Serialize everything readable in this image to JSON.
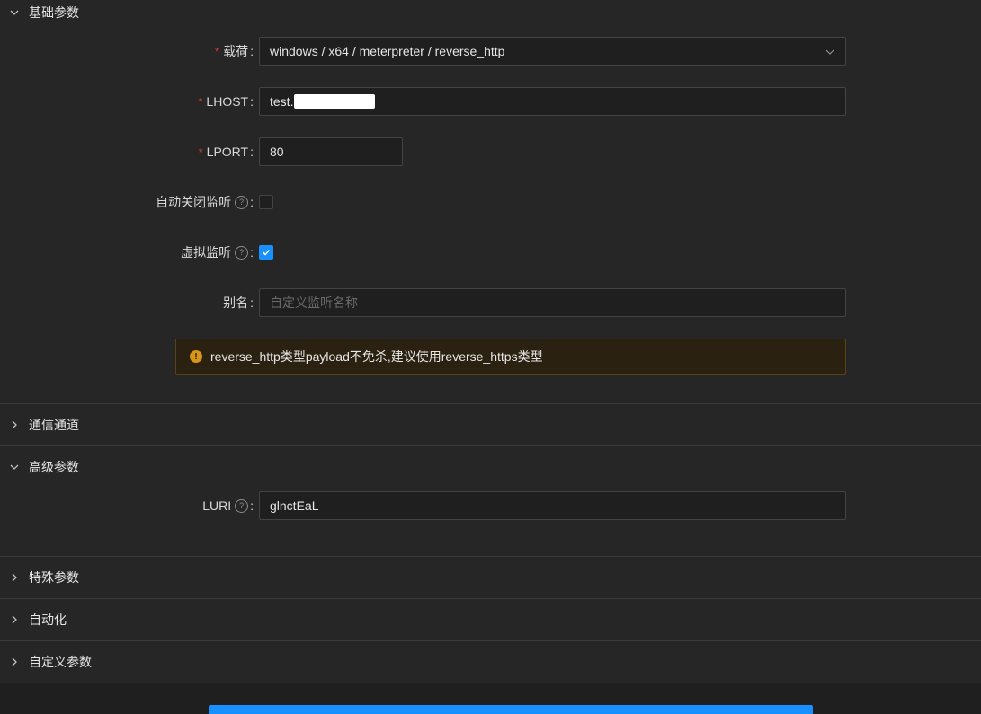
{
  "panels": {
    "basic": {
      "title": "基础参数",
      "expanded": true
    },
    "channel": {
      "title": "通信通道",
      "expanded": false
    },
    "advanced": {
      "title": "高级参数",
      "expanded": true
    },
    "special": {
      "title": "特殊参数",
      "expanded": false
    },
    "automation": {
      "title": "自动化",
      "expanded": false
    },
    "custom": {
      "title": "自定义参数",
      "expanded": false
    }
  },
  "form": {
    "payload": {
      "label": "载荷",
      "value": "windows / x64 / meterpreter / reverse_http",
      "required": true
    },
    "lhost": {
      "label": "LHOST",
      "value": "test.",
      "required": true
    },
    "lport": {
      "label": "LPORT",
      "value": "80",
      "required": true
    },
    "auto_close": {
      "label": "自动关闭监听",
      "checked": false
    },
    "virtual": {
      "label": "虚拟监听",
      "checked": true
    },
    "alias": {
      "label": "别名",
      "value": "",
      "placeholder": "自定义监听名称"
    },
    "luri": {
      "label": "LURI",
      "value": "glnctEaL"
    }
  },
  "alert": {
    "type": "warning",
    "text": "reverse_http类型payload不免杀,建议使用reverse_https类型"
  },
  "colors": {
    "accent": "#1890ff",
    "required": "#e03a3a",
    "warning": "#d89614"
  }
}
